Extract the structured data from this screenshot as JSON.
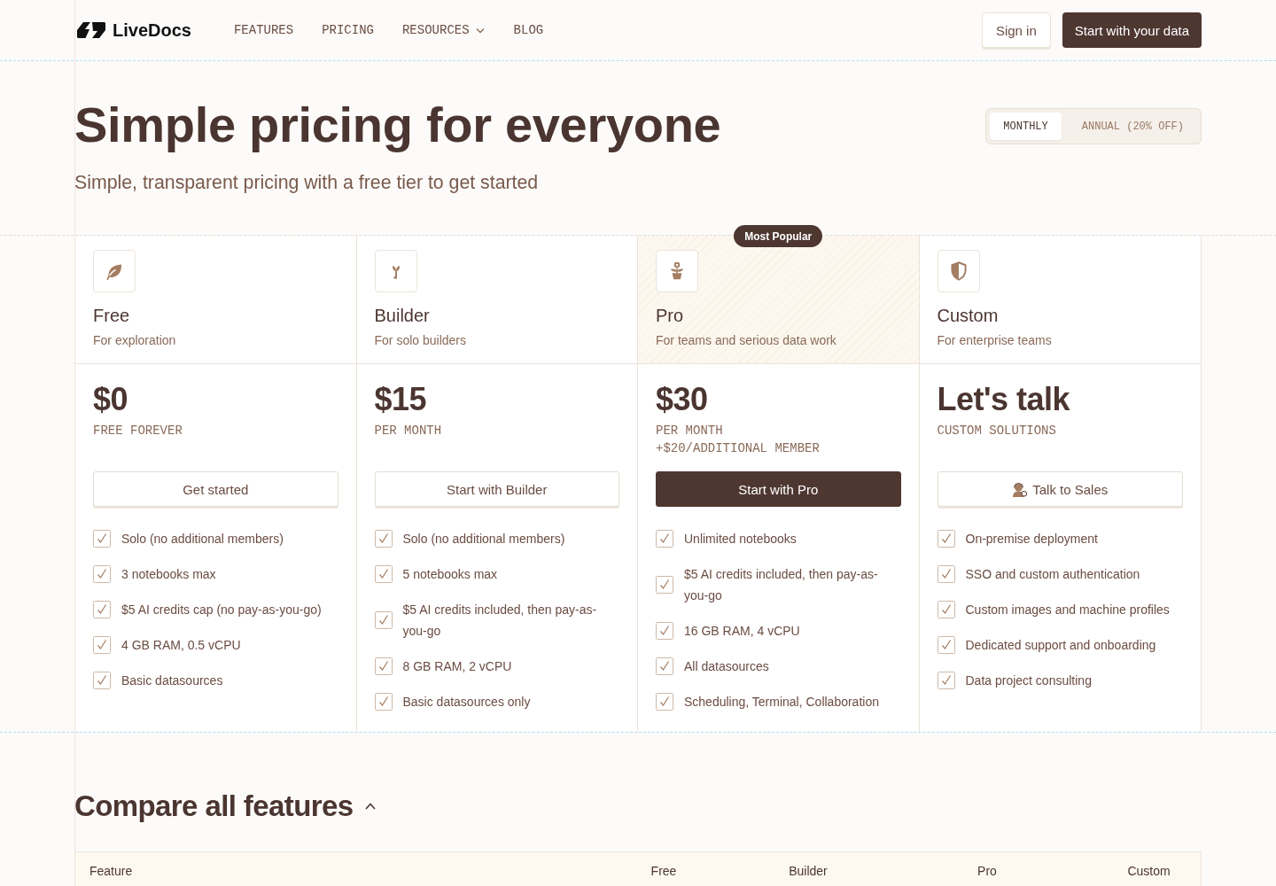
{
  "nav": {
    "logo": "LiveDocs",
    "links": [
      {
        "label": "FEATURES",
        "dropdown": false
      },
      {
        "label": "PRICING",
        "dropdown": false
      },
      {
        "label": "RESOURCES",
        "dropdown": true
      },
      {
        "label": "BLOG",
        "dropdown": false
      }
    ],
    "sign_in": "Sign in",
    "cta": "Start with your data"
  },
  "hero": {
    "title": "Simple pricing for everyone",
    "subtitle": "Simple, transparent pricing with a free tier to get started",
    "billing_toggle": [
      {
        "label": "MONTHLY",
        "selected": true
      },
      {
        "label": "ANNUAL (20% OFF)",
        "selected": false
      }
    ]
  },
  "plans": [
    {
      "name": "Free",
      "tagline": "For exploration",
      "highlighted": false,
      "price": "$0",
      "period": [
        "FREE FOREVER"
      ],
      "button": {
        "label": "Get started",
        "primary": false
      },
      "features": [
        "Solo (no additional members)",
        "3 notebooks max",
        "$5 AI credits cap (no pay-as-you-go)",
        "4 GB RAM, 0.5 vCPU",
        "Basic datasources"
      ]
    },
    {
      "name": "Builder",
      "tagline": "For solo builders",
      "highlighted": false,
      "price": "$15",
      "period": [
        "PER MONTH"
      ],
      "button": {
        "label": "Start with Builder",
        "primary": false
      },
      "features": [
        "Solo (no additional members)",
        "5 notebooks max",
        "$5 AI credits included, then pay-as-you-go",
        "8 GB RAM, 2 vCPU",
        "Basic datasources only"
      ]
    },
    {
      "name": "Pro",
      "tagline": "For teams and serious data work",
      "highlighted": true,
      "badge": "Most Popular",
      "price": "$30",
      "period": [
        "PER MONTH",
        "+$20/ADDITIONAL MEMBER"
      ],
      "button": {
        "label": "Start with Pro",
        "primary": true
      },
      "features": [
        "Unlimited notebooks",
        "$5 AI credits included, then pay-as-you-go",
        "16 GB RAM, 4 vCPU",
        "All datasources",
        "Scheduling, Terminal, Collaboration"
      ]
    },
    {
      "name": "Custom",
      "tagline": "For enterprise teams",
      "highlighted": false,
      "price": "Let's talk",
      "period": [
        "CUSTOM SOLUTIONS"
      ],
      "button": {
        "label": "Talk to Sales",
        "primary": false
      },
      "features": [
        "On-premise deployment",
        "SSO and custom authentication",
        "Custom images and machine profiles",
        "Dedicated support and onboarding",
        "Data project consulting"
      ]
    }
  ],
  "compare": {
    "title": "Compare all features",
    "expanded": true,
    "columns": [
      "Feature",
      "Free",
      "Builder",
      "Pro",
      "Custom"
    ]
  }
}
